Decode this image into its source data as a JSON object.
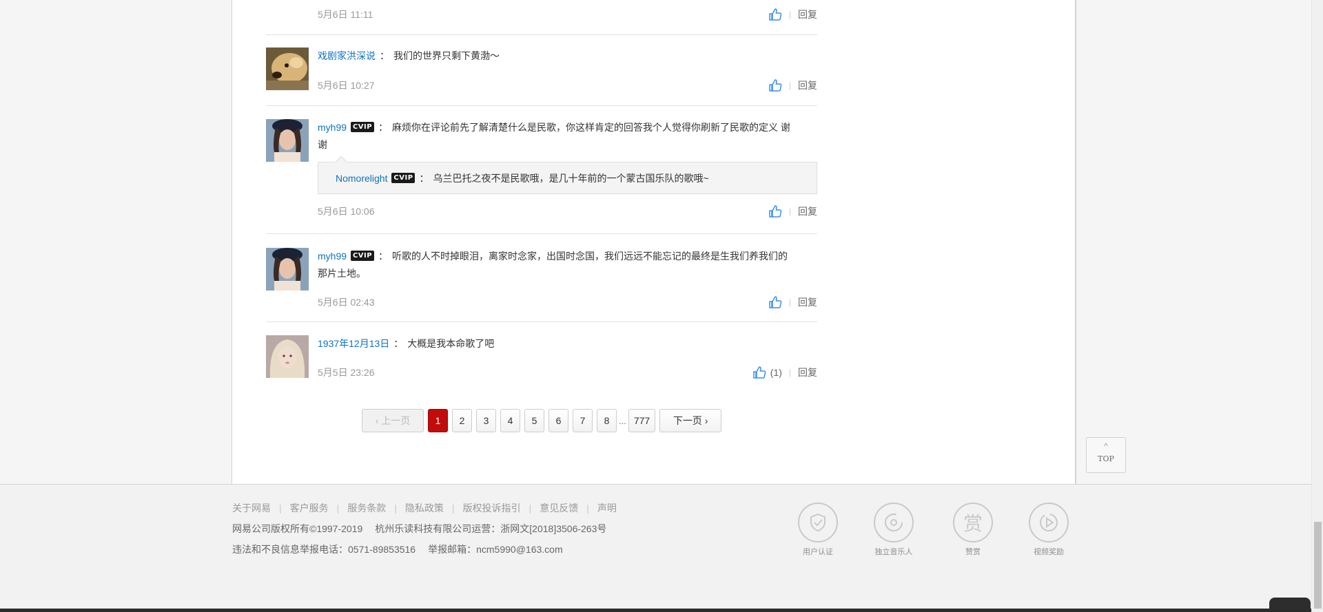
{
  "colors": {
    "accent": "#c20c0c",
    "link": "#0c73c2",
    "meta": "#999999"
  },
  "comments": [
    {
      "time": "5月6日 11:11",
      "reply": "回复"
    },
    {
      "user": "戏剧家洪深说",
      "text": "我们的世界只剩下黄渤～",
      "time": "5月6日 10:27",
      "reply": "回复"
    },
    {
      "user": "myh99",
      "vip": "CVIP",
      "text1": "麻烦你在评论前先了解清楚什么是民歌，你这样肯定的回答我个人觉得你刷新了民歌的定义 谢",
      "text2": "谢",
      "quote_user": "Nomorelight",
      "quote_vip": "CVIP",
      "quote_text": "乌兰巴托之夜不是民歌哦，是几十年前的一个蒙古国乐队的歌哦~",
      "time": "5月6日 10:06",
      "reply": "回复"
    },
    {
      "user": "myh99",
      "vip": "CVIP",
      "text1": "听歌的人不时掉眼泪，离家时念家，出国时念国，我们远远不能忘记的最终是生我们养我们的",
      "text2": "那片土地。",
      "time": "5月6日 02:43",
      "reply": "回复"
    },
    {
      "user": "1937年12月13日",
      "text": "大概是我本命歌了吧",
      "time": "5月5日 23:26",
      "likes": "(1)",
      "reply": "回复"
    }
  ],
  "pager": {
    "prev": "上一页",
    "pages": [
      "1",
      "2",
      "3",
      "4",
      "5",
      "6",
      "7",
      "8"
    ],
    "ellipsis": "...",
    "last": "777",
    "next": "下一页",
    "current": "1"
  },
  "top_button": {
    "label": "TOP"
  },
  "footer": {
    "links": [
      "关于网易",
      "客户服务",
      "服务条款",
      "隐私政策",
      "版权投诉指引",
      "意见反馈",
      "声明"
    ],
    "separator": "|",
    "copyright": "网易公司版权所有©1997-2019",
    "operator": "杭州乐读科技有限公司运营：浙网文[2018]3506-263号",
    "report_phone": "违法和不良信息举报电话：0571-89853516",
    "report_email": "举报邮箱：ncm5990@163.com",
    "badges": [
      {
        "label": "用户认证",
        "icon": "shield-check-icon"
      },
      {
        "label": "独立音乐人",
        "icon": "music-disc-icon"
      },
      {
        "label": "赞赏",
        "icon": "reward-icon",
        "glyph": "赏"
      },
      {
        "label": "视频奖励",
        "icon": "video-play-icon"
      }
    ]
  }
}
